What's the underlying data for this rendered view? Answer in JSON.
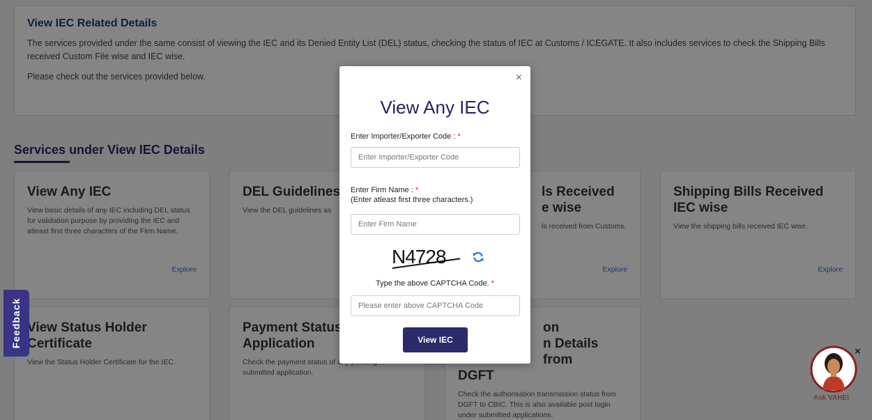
{
  "intro": {
    "title": "View IEC Related Details",
    "text1": "The services provided under the same consist of viewing the IEC and its Denied Entity List (DEL) status, checking the status of IEC at Customs / ICEGATE. It also includes services to check the Shipping Bills received Custom File wise and IEC wise.",
    "text2": "Please check out the services provided below."
  },
  "services_heading": "Services under View IEC Details",
  "cards": [
    {
      "title": "View Any IEC",
      "desc": "View basic details of any IEC including DEL status for validation purpose by providing the IEC and atleast first three characters of the Firm Name.",
      "link": "Explore"
    },
    {
      "title": "DEL Guidelines",
      "desc": "View the DEL guidelines as",
      "link": ""
    },
    {
      "title": "ls Received",
      "title2": "e wise",
      "desc": "ls received from Customs.",
      "link": "Explore"
    },
    {
      "title": "Shipping Bills Received IEC wise",
      "desc": "View the shipping bills received IEC wise.",
      "link": "Explore"
    },
    {
      "title": "View Status Holder Certificate",
      "desc": "View the Status Holder Certificate for the IEC.",
      "link": ""
    },
    {
      "title": "Payment Status",
      "title2": "Application",
      "desc": "Check the payment status of any pending / submitted application.",
      "link": ""
    },
    {
      "title": "on",
      "title2": "n Details from",
      "title3": "DGFT",
      "desc": "Check the authorisation transmission status from DGFT to CBIC. This is also available post login under submitted applications.",
      "link": ""
    }
  ],
  "modal": {
    "close": "×",
    "title": "View Any IEC",
    "iec_label": "Enter Importer/Exporter Code :",
    "iec_placeholder": "Enter Importer/Exporter Code",
    "firm_label": "Enter Firm Name :",
    "firm_hint": "(Enter atleast first three characters.)",
    "firm_placeholder": "Enter Firm Name",
    "captcha_text": "N4728",
    "captcha_hint": "Type the above CAPTCHA Code.",
    "captcha_placeholder": "Please enter above CAPTCHA Code",
    "required_mark": "*",
    "submit_label": "View IEC"
  },
  "feedback": {
    "label": "Feedback"
  },
  "assistant": {
    "label": "Ask VAHEI",
    "close": "×"
  },
  "colors": {
    "primary": "#2c2a6a",
    "link": "#3a6bd6",
    "required": "#d42020",
    "refresh": "#2e7bd6"
  }
}
